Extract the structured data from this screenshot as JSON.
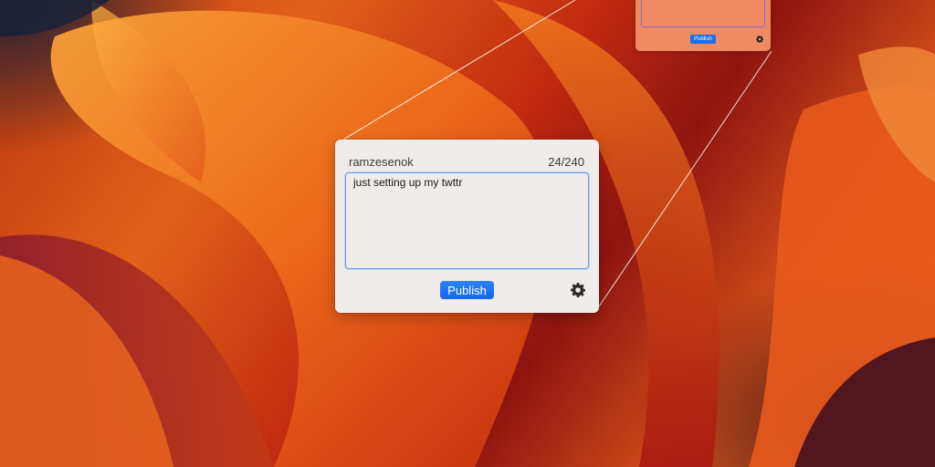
{
  "popover": {
    "username": "ramzesenok",
    "char_count": "24/240",
    "tweet_text": "just setting up my twttr",
    "publish_label": "Publish"
  },
  "mini_popover": {
    "publish_label": "Publish"
  },
  "icons": {
    "settings": "gear-icon"
  },
  "colors": {
    "accent": "#1a6ef0",
    "popover_bg": "#f0ecea",
    "focus_ring": "#6a9ff0"
  }
}
